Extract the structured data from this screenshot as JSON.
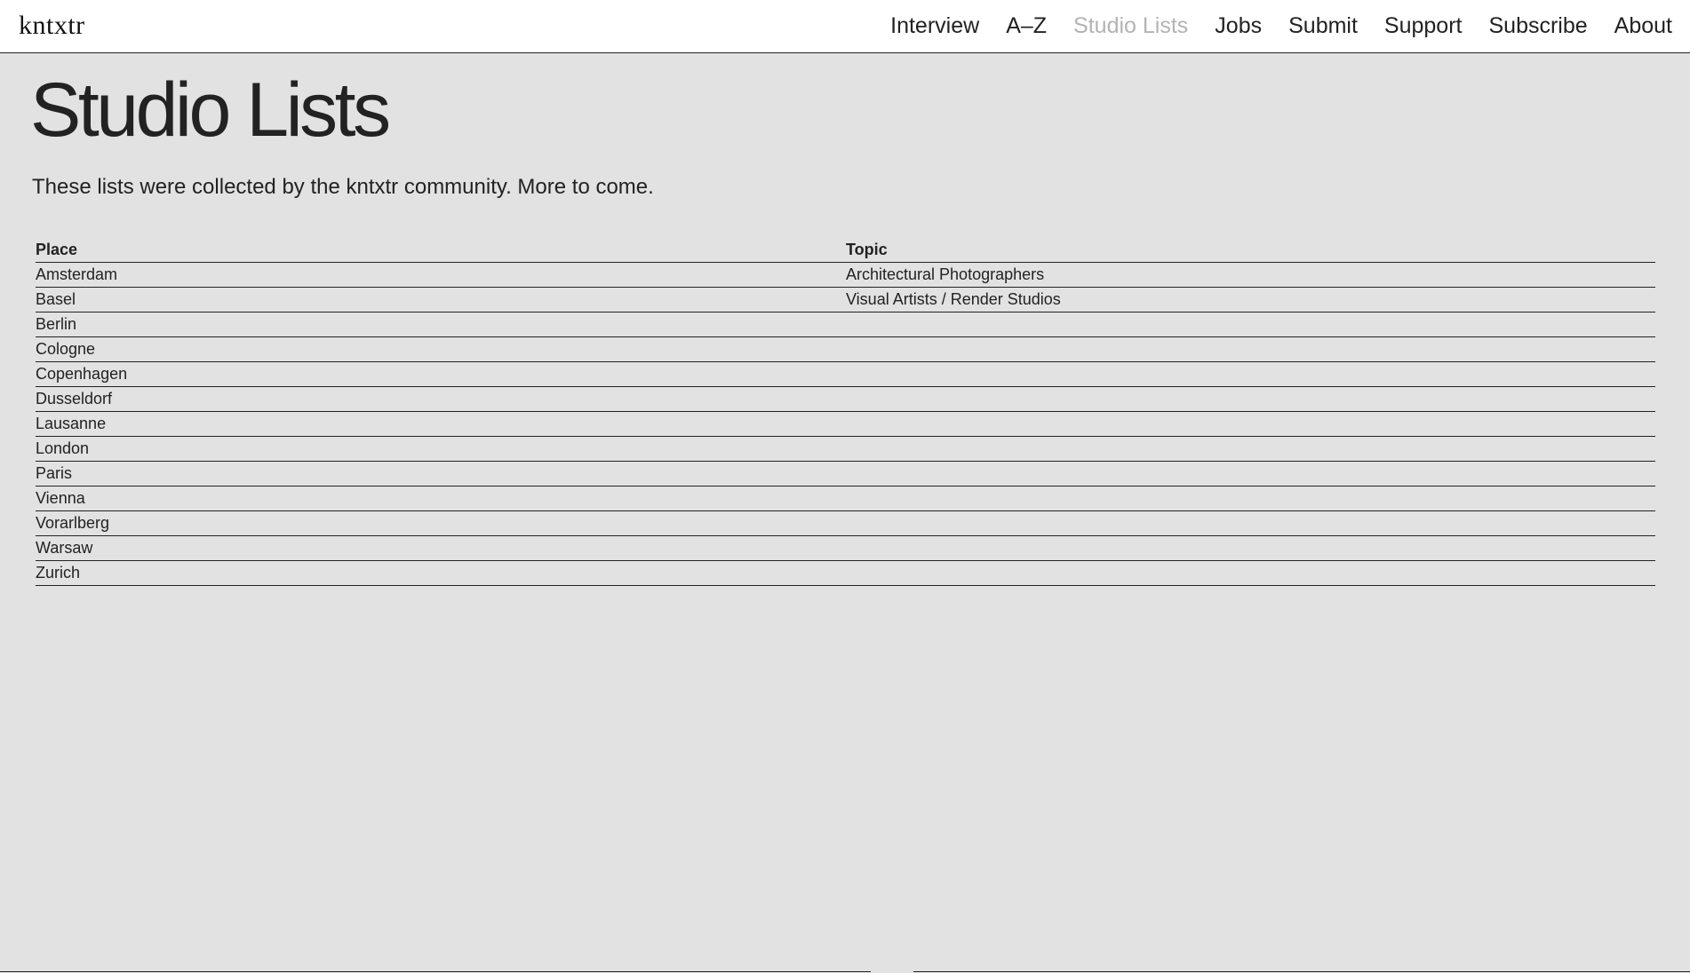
{
  "header": {
    "logo": "kntxtr",
    "nav": [
      {
        "label": "Interview",
        "active": false
      },
      {
        "label": "A–Z",
        "active": false
      },
      {
        "label": "Studio Lists",
        "active": true
      },
      {
        "label": "Jobs",
        "active": false
      },
      {
        "label": "Submit",
        "active": false
      },
      {
        "label": "Support",
        "active": false
      },
      {
        "label": "Subscribe",
        "active": false
      },
      {
        "label": "About",
        "active": false
      }
    ]
  },
  "main": {
    "title": "Studio Lists",
    "intro": "These lists were collected by the kntxtr community. More to come."
  },
  "table": {
    "headers": {
      "place": "Place",
      "topic": "Topic"
    },
    "places": [
      "Amsterdam",
      "Basel",
      "Berlin",
      "Cologne",
      "Copenhagen",
      "Dusseldorf",
      "Lausanne",
      "London",
      "Paris",
      "Vienna",
      "Vorarlberg",
      "Warsaw",
      "Zurich"
    ],
    "topics": [
      "Architectural Photographers",
      "Visual Artists / Render Studios"
    ]
  },
  "colors": {
    "background": "#e2e2e2",
    "header_background": "#ffffff",
    "text": "#222222",
    "active_nav": "#b3b3b3"
  }
}
